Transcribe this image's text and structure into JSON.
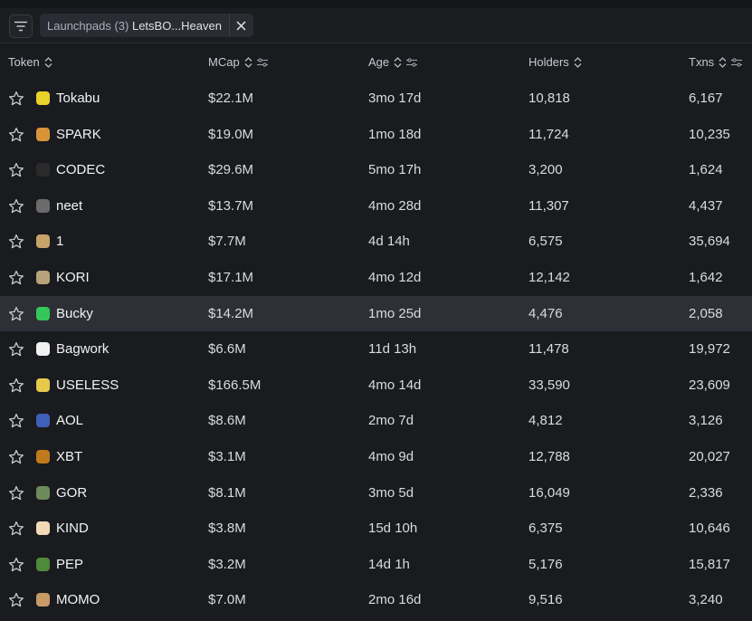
{
  "filter": {
    "chip_label": "Launchpads (3)",
    "chip_value": "LetsBO...Heaven"
  },
  "columns": {
    "token": "Token",
    "mcap": "MCap",
    "age": "Age",
    "holders": "Holders",
    "txns": "Txns"
  },
  "rows": [
    {
      "name": "Tokabu",
      "mcap": "$22.1M",
      "age": "3mo 17d",
      "holders": "10,818",
      "txns": "6,167",
      "icon_color": "#e9d22a"
    },
    {
      "name": "SPARK",
      "mcap": "$19.0M",
      "age": "1mo 18d",
      "holders": "11,724",
      "txns": "10,235",
      "icon_color": "#d9943a"
    },
    {
      "name": "CODEC",
      "mcap": "$29.6M",
      "age": "5mo 17h",
      "holders": "3,200",
      "txns": "1,624",
      "icon_color": "#2b2b2b"
    },
    {
      "name": "neet",
      "mcap": "$13.7M",
      "age": "4mo 28d",
      "holders": "11,307",
      "txns": "4,437",
      "icon_color": "#6b6b6b"
    },
    {
      "name": "1",
      "mcap": "$7.7M",
      "age": "4d 14h",
      "holders": "6,575",
      "txns": "35,694",
      "icon_color": "#c9a26a"
    },
    {
      "name": "KORI",
      "mcap": "$17.1M",
      "age": "4mo 12d",
      "holders": "12,142",
      "txns": "1,642",
      "icon_color": "#b8a27a"
    },
    {
      "name": "Bucky",
      "mcap": "$14.2M",
      "age": "1mo 25d",
      "holders": "4,476",
      "txns": "2,058",
      "icon_color": "#34c759"
    },
    {
      "name": "Bagwork",
      "mcap": "$6.6M",
      "age": "11d 13h",
      "holders": "11,478",
      "txns": "19,972",
      "icon_color": "#f1f1f1"
    },
    {
      "name": "USELESS",
      "mcap": "$166.5M",
      "age": "4mo 14d",
      "holders": "33,590",
      "txns": "23,609",
      "icon_color": "#e6c84a"
    },
    {
      "name": "AOL",
      "mcap": "$8.6M",
      "age": "2mo 7d",
      "holders": "4,812",
      "txns": "3,126",
      "icon_color": "#3f5fb8"
    },
    {
      "name": "XBT",
      "mcap": "$3.1M",
      "age": "4mo 9d",
      "holders": "12,788",
      "txns": "20,027",
      "icon_color": "#c07a1a"
    },
    {
      "name": "GOR",
      "mcap": "$8.1M",
      "age": "3mo 5d",
      "holders": "16,049",
      "txns": "2,336",
      "icon_color": "#6d8a5a"
    },
    {
      "name": "KIND",
      "mcap": "$3.8M",
      "age": "15d 10h",
      "holders": "6,375",
      "txns": "10,646",
      "icon_color": "#f3d9b8"
    },
    {
      "name": "PEP",
      "mcap": "$3.2M",
      "age": "14d 1h",
      "holders": "5,176",
      "txns": "15,817",
      "icon_color": "#4f8a3a"
    },
    {
      "name": "MOMO",
      "mcap": "$7.0M",
      "age": "2mo 16d",
      "holders": "9,516",
      "txns": "3,240",
      "icon_color": "#c79a66"
    }
  ],
  "highlighted_row": "Bucky",
  "colors": {
    "background": "#1a1b1f",
    "row_highlight": "#2e3037",
    "chip_bg": "#2a2c33"
  },
  "icons": {
    "filter": "filter-icon",
    "close": "close-icon",
    "sort": "sort-icon",
    "settings": "sliders-icon",
    "star": "star-icon"
  }
}
